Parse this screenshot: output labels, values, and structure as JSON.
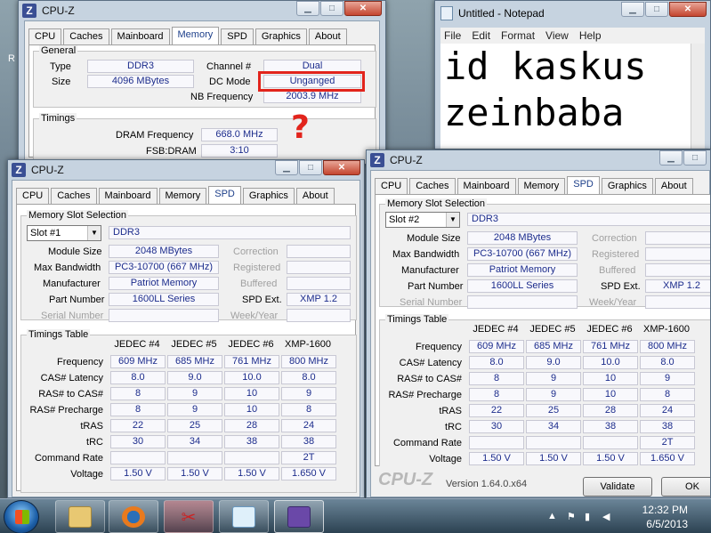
{
  "desktop": {
    "edge_letter": "R"
  },
  "cpuz_app": {
    "title": "CPU-Z",
    "tabs": [
      "CPU",
      "Caches",
      "Mainboard",
      "Memory",
      "SPD",
      "Graphics",
      "About"
    ]
  },
  "win1": {
    "active_tab": "Memory",
    "general": {
      "label": "General",
      "type_label": "Type",
      "type": "DDR3",
      "size_label": "Size",
      "size": "4096 MBytes",
      "channel_label": "Channel #",
      "channel": "Dual",
      "dcmode_label": "DC Mode",
      "dcmode": "Unganged",
      "nbfreq_label": "NB Frequency",
      "nbfreq": "2003.9 MHz"
    },
    "timings": {
      "label": "Timings",
      "dram_label": "DRAM Frequency",
      "dram": "668.0 MHz",
      "fsb_label": "FSB:DRAM",
      "fsb": "3:10"
    },
    "annotation": "?"
  },
  "spd_labels": {
    "slot_group": "Memory Slot Selection",
    "module_size": "Module Size",
    "max_bw": "Max Bandwidth",
    "manufacturer": "Manufacturer",
    "part_number": "Part Number",
    "serial_number": "Serial Number",
    "correction": "Correction",
    "registered": "Registered",
    "buffered": "Buffered",
    "spd_ext": "SPD Ext.",
    "week_year": "Week/Year",
    "timings_table": "Timings Table",
    "cols": [
      "JEDEC #4",
      "JEDEC #5",
      "JEDEC #6",
      "XMP-1600"
    ],
    "rows": [
      "Frequency",
      "CAS# Latency",
      "RAS# to CAS#",
      "RAS# Precharge",
      "tRAS",
      "tRC",
      "Command Rate",
      "Voltage"
    ]
  },
  "win2": {
    "slot": "Slot #1",
    "type": "DDR3",
    "module_size": "2048 MBytes",
    "max_bw": "PC3-10700 (667 MHz)",
    "manufacturer": "Patriot Memory",
    "part_number": "1600LL Series",
    "spd_ext": "XMP 1.2",
    "table": [
      [
        "609 MHz",
        "685 MHz",
        "761 MHz",
        "800 MHz"
      ],
      [
        "8.0",
        "9.0",
        "10.0",
        "8.0"
      ],
      [
        "8",
        "9",
        "10",
        "9"
      ],
      [
        "8",
        "9",
        "10",
        "8"
      ],
      [
        "22",
        "25",
        "28",
        "24"
      ],
      [
        "30",
        "34",
        "38",
        "38"
      ],
      [
        "",
        "",
        "",
        "2T"
      ],
      [
        "1.50 V",
        "1.50 V",
        "1.50 V",
        "1.650 V"
      ]
    ]
  },
  "win3": {
    "slot": "Slot #2",
    "type": "DDR3",
    "module_size": "2048 MBytes",
    "max_bw": "PC3-10700 (667 MHz)",
    "manufacturer": "Patriot Memory",
    "part_number": "1600LL Series",
    "spd_ext": "XMP 1.2",
    "table": [
      [
        "609 MHz",
        "685 MHz",
        "761 MHz",
        "800 MHz"
      ],
      [
        "8.0",
        "9.0",
        "10.0",
        "8.0"
      ],
      [
        "8",
        "9",
        "10",
        "9"
      ],
      [
        "8",
        "9",
        "10",
        "8"
      ],
      [
        "22",
        "25",
        "28",
        "24"
      ],
      [
        "30",
        "34",
        "38",
        "38"
      ],
      [
        "",
        "",
        "",
        "2T"
      ],
      [
        "1.50 V",
        "1.50 V",
        "1.50 V",
        "1.650 V"
      ]
    ],
    "footer_logo": "CPU-Z",
    "version": "Version 1.64.0.x64",
    "validate": "Validate",
    "ok": "OK"
  },
  "notepad": {
    "title": "Untitled - Notepad",
    "menus": [
      "File",
      "Edit",
      "Format",
      "View",
      "Help"
    ],
    "line1": "id kaskus",
    "line2": "zeinbaba"
  },
  "taskbar": {
    "time": "12:32 PM",
    "date": "6/5/2013"
  }
}
